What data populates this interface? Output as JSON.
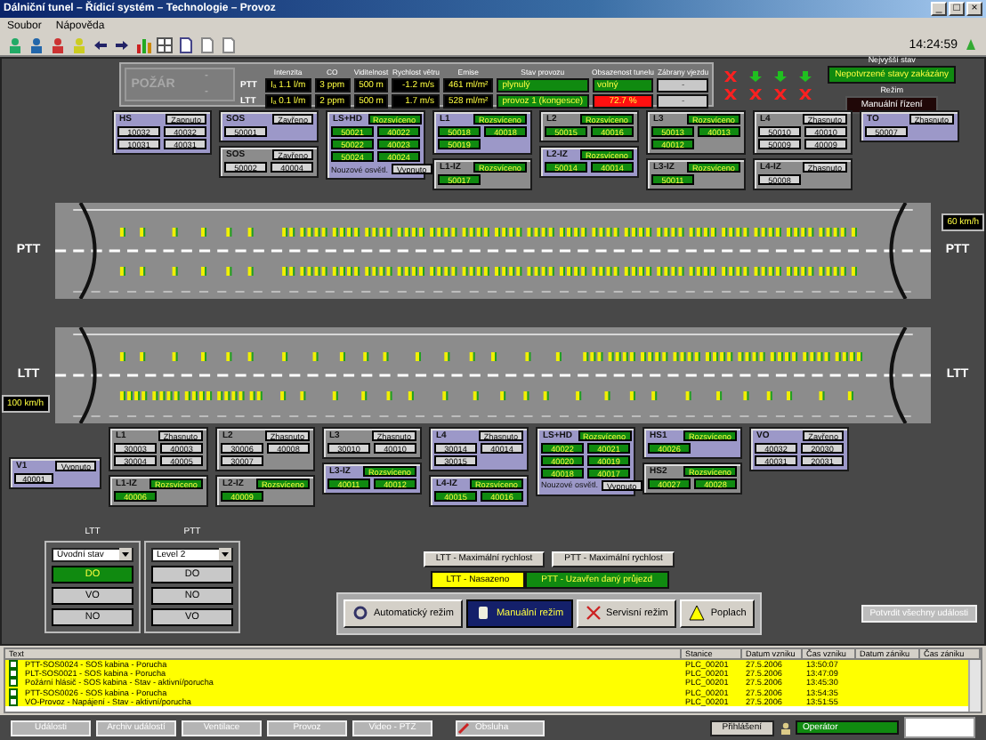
{
  "window": {
    "title": "Dálniční tunel – Řídicí systém – Technologie – Provoz",
    "controls": [
      "_",
      "□",
      "×"
    ]
  },
  "menu": [
    "Soubor",
    "Nápověda"
  ],
  "clock": "14:24:59",
  "fire": {
    "label": "POŽÁR",
    "values": [
      "-",
      "-"
    ]
  },
  "readings": {
    "columns": [
      "Intenzita",
      "CO",
      "Viditelnost",
      "Rychlost větru",
      "Emise",
      "Stav provozu",
      "Obsazenost tunelu",
      "Zábrany vjezdu"
    ],
    "rows": [
      {
        "name": "PTT",
        "cells": [
          {
            "text": "Iₐ 1.1 l/m",
            "kind": "value"
          },
          {
            "text": "3 ppm",
            "kind": "value"
          },
          {
            "text": "500 m",
            "kind": "value"
          },
          {
            "text": "-1.2 m/s",
            "kind": "value"
          },
          {
            "text": "461 ml/m²",
            "kind": "value"
          },
          {
            "text": "plynulý",
            "kind": "status"
          },
          {
            "text": "volný",
            "kind": "status"
          },
          {
            "text": "-",
            "kind": "off"
          }
        ]
      },
      {
        "name": "LTT",
        "cells": [
          {
            "text": "Iₐ 0.1 l/m",
            "kind": "value"
          },
          {
            "text": "2 ppm",
            "kind": "value"
          },
          {
            "text": "500 m",
            "kind": "value"
          },
          {
            "text": "1.7 m/s",
            "kind": "value"
          },
          {
            "text": "528 ml/m²",
            "kind": "value"
          },
          {
            "text": "provoz 1 (kongesce)",
            "kind": "status"
          },
          {
            "text": "72.7 %",
            "kind": "alarm"
          },
          {
            "text": "-",
            "kind": "off"
          }
        ]
      }
    ]
  },
  "signals": [
    {
      "kind": "cross",
      "color": "#ff2020"
    },
    {
      "kind": "arrow",
      "color": "#20c020"
    },
    {
      "kind": "arrow",
      "color": "#20c020"
    },
    {
      "kind": "arrow",
      "color": "#20c020"
    },
    {
      "kind": "cross",
      "color": "#ff2020"
    },
    {
      "kind": "cross",
      "color": "#ff2020"
    },
    {
      "kind": "cross",
      "color": "#ff2020"
    },
    {
      "kind": "cross",
      "color": "#ff2020"
    }
  ],
  "highest_state": {
    "label": "Nejvyšší stav",
    "value": "Nepotvrzené stavy zakázány"
  },
  "mode": {
    "label": "Režim",
    "value": "Manuální řízení"
  },
  "top_columns": [
    {
      "groups": [
        {
          "name": "HS",
          "color": "#9c98c8",
          "status": {
            "text": "Zapnuto",
            "kind": "idle"
          },
          "values": [
            {
              "text": "10032",
              "kind": "idle"
            },
            {
              "text": "40032",
              "kind": "idle"
            },
            {
              "text": "10031",
              "kind": "idle"
            },
            {
              "text": "40031",
              "kind": "idle"
            }
          ]
        }
      ]
    },
    {
      "groups": [
        {
          "name": "SOS",
          "color": "#9c98c8",
          "status": {
            "text": "Zavřeno",
            "kind": "idle"
          },
          "values": [
            {
              "text": "50001",
              "kind": "idle"
            }
          ]
        },
        {
          "name": "SOS",
          "color": "#8c8c8c",
          "status": {
            "text": "Zavřeno",
            "kind": "idle"
          },
          "values": [
            {
              "text": "50002",
              "kind": "idle"
            },
            {
              "text": "40004",
              "kind": "idle"
            }
          ]
        }
      ]
    },
    {
      "groups": [
        {
          "name": "LS+HD",
          "color": "#9c98c8",
          "status": {
            "text": "Rozsvíceno",
            "kind": "active"
          },
          "values": [
            {
              "text": "50021",
              "kind": "active"
            },
            {
              "text": "40022",
              "kind": "active"
            },
            {
              "text": "50022",
              "kind": "active"
            },
            {
              "text": "40023",
              "kind": "active"
            },
            {
              "text": "50024",
              "kind": "active"
            },
            {
              "text": "40024",
              "kind": "active"
            }
          ],
          "footer": {
            "label": "Nouzové osvětl.",
            "status": "Vypnuto"
          }
        }
      ]
    },
    {
      "groups": [
        {
          "name": "L1",
          "color": "#9c98c8",
          "status": {
            "text": "Rozsvíceno",
            "kind": "active"
          },
          "values": [
            {
              "text": "50018",
              "kind": "active"
            },
            {
              "text": "40018",
              "kind": "active"
            },
            {
              "text": "50019",
              "kind": "active"
            }
          ]
        },
        {
          "name": "L1-IZ",
          "color": "#8c8c8c",
          "status": {
            "text": "Rozsvíceno",
            "kind": "active"
          },
          "values": [
            {
              "text": "50017",
              "kind": "active"
            }
          ]
        }
      ]
    },
    {
      "groups": [
        {
          "name": "L2",
          "color": "#8c8c8c",
          "status": {
            "text": "Rozsvíceno",
            "kind": "active"
          },
          "values": [
            {
              "text": "50015",
              "kind": "active"
            },
            {
              "text": "40016",
              "kind": "active"
            }
          ]
        },
        {
          "name": "L2-IZ",
          "color": "#9c98c8",
          "status": {
            "text": "Rozsvíceno",
            "kind": "active"
          },
          "values": [
            {
              "text": "50014",
              "kind": "active"
            },
            {
              "text": "40014",
              "kind": "active"
            }
          ]
        }
      ]
    },
    {
      "groups": [
        {
          "name": "L3",
          "color": "#8c8c8c",
          "status": {
            "text": "Rozsvíceno",
            "kind": "active"
          },
          "values": [
            {
              "text": "50013",
              "kind": "active"
            },
            {
              "text": "40013",
              "kind": "active"
            },
            {
              "text": "40012",
              "kind": "active"
            }
          ]
        },
        {
          "name": "L3-IZ",
          "color": "#8c8c8c",
          "status": {
            "text": "Rozsvíceno",
            "kind": "active"
          },
          "values": [
            {
              "text": "50011",
              "kind": "active"
            }
          ]
        }
      ]
    },
    {
      "groups": [
        {
          "name": "L4",
          "color": "#8c8c8c",
          "status": {
            "text": "Zhasnuto",
            "kind": "idle"
          },
          "values": [
            {
              "text": "50010",
              "kind": "idle"
            },
            {
              "text": "40010",
              "kind": "idle"
            },
            {
              "text": "50009",
              "kind": "idle"
            },
            {
              "text": "40009",
              "kind": "idle"
            }
          ]
        },
        {
          "name": "L4-IZ",
          "color": "#8c8c8c",
          "status": {
            "text": "Zhasnuto",
            "kind": "idle"
          },
          "values": [
            {
              "text": "50008",
              "kind": "idle"
            }
          ]
        }
      ]
    },
    {
      "groups": [
        {
          "name": "TO",
          "color": "#9c98c8",
          "status": {
            "text": "Zhasnuto",
            "kind": "idle"
          },
          "values": [
            {
              "text": "50007",
              "kind": "idle"
            }
          ]
        }
      ]
    }
  ],
  "tubes": [
    {
      "left": {
        "label": "PTT"
      },
      "right": {
        "label": "PTT",
        "speed": "60 km/h"
      }
    },
    {
      "left": {
        "label": "LTT",
        "speed": "100 km/h"
      },
      "right": {
        "label": "LTT"
      }
    }
  ],
  "bottom_columns": [
    {
      "groups": [
        {
          "name": "V1",
          "color": "#9c98c8",
          "status": {
            "text": "Vypnuto",
            "kind": "idle"
          },
          "values": [
            {
              "text": "40001",
              "kind": "idle"
            }
          ]
        }
      ]
    },
    {
      "groups": [
        {
          "name": "L1",
          "color": "#8c8c8c",
          "status": {
            "text": "Zhasnuto",
            "kind": "idle"
          },
          "values": [
            {
              "text": "30003",
              "kind": "idle"
            },
            {
              "text": "40003",
              "kind": "idle"
            },
            {
              "text": "30004",
              "kind": "idle"
            },
            {
              "text": "40005",
              "kind": "idle"
            }
          ]
        },
        {
          "name": "L1-IZ",
          "color": "#8c8c8c",
          "status": {
            "text": "Rozsvíceno",
            "kind": "active"
          },
          "values": [
            {
              "text": "40006",
              "kind": "active"
            }
          ]
        }
      ]
    },
    {
      "groups": [
        {
          "name": "L2",
          "color": "#8c8c8c",
          "status": {
            "text": "Zhasnuto",
            "kind": "idle"
          },
          "values": [
            {
              "text": "30006",
              "kind": "idle"
            },
            {
              "text": "40008",
              "kind": "idle"
            },
            {
              "text": "30007",
              "kind": "idle"
            }
          ]
        },
        {
          "name": "L2-IZ",
          "color": "#8c8c8c",
          "status": {
            "text": "Rozsvíceno",
            "kind": "active"
          },
          "values": [
            {
              "text": "40009",
              "kind": "active"
            }
          ]
        }
      ]
    },
    {
      "groups": [
        {
          "name": "L3",
          "color": "#8c8c8c",
          "status": {
            "text": "Zhasnuto",
            "kind": "idle"
          },
          "values": [
            {
              "text": "30010",
              "kind": "idle"
            },
            {
              "text": "40010",
              "kind": "idle"
            }
          ]
        },
        {
          "name": "L3-IZ",
          "color": "#9c98c8",
          "status": {
            "text": "Rozsvíceno",
            "kind": "active"
          },
          "values": [
            {
              "text": "40011",
              "kind": "active"
            },
            {
              "text": "40012",
              "kind": "active"
            }
          ]
        }
      ]
    },
    {
      "groups": [
        {
          "name": "L4",
          "color": "#9c98c8",
          "status": {
            "text": "Zhasnuto",
            "kind": "idle"
          },
          "values": [
            {
              "text": "30014",
              "kind": "idle"
            },
            {
              "text": "40014",
              "kind": "idle"
            },
            {
              "text": "30015",
              "kind": "idle"
            }
          ]
        },
        {
          "name": "L4-IZ",
          "color": "#9c98c8",
          "status": {
            "text": "Rozsvíceno",
            "kind": "active"
          },
          "values": [
            {
              "text": "40015",
              "kind": "active"
            },
            {
              "text": "40016",
              "kind": "active"
            }
          ]
        }
      ]
    },
    {
      "groups": [
        {
          "name": "LS+HD",
          "color": "#9c98c8",
          "status": {
            "text": "Rozsvíceno",
            "kind": "active"
          },
          "values": [
            {
              "text": "40022",
              "kind": "active"
            },
            {
              "text": "40021",
              "kind": "active"
            },
            {
              "text": "40020",
              "kind": "active"
            },
            {
              "text": "40019",
              "kind": "active"
            },
            {
              "text": "40018",
              "kind": "active"
            },
            {
              "text": "40017",
              "kind": "active"
            }
          ],
          "footer": {
            "label": "Nouzové osvětl.",
            "status": "Vypnuto"
          }
        }
      ]
    },
    {
      "groups": [
        {
          "name": "HS1",
          "color": "#9c98c8",
          "status": {
            "text": "Rozsvíceno",
            "kind": "active"
          },
          "values": [
            {
              "text": "40026",
              "kind": "active"
            }
          ]
        },
        {
          "name": "HS2",
          "color": "#8c8c8c",
          "status": {
            "text": "Rozsvíceno",
            "kind": "active"
          },
          "values": [
            {
              "text": "40027",
              "kind": "active"
            },
            {
              "text": "40028",
              "kind": "active"
            }
          ]
        }
      ]
    },
    {
      "groups": [
        {
          "name": "VO",
          "color": "#9c98c8",
          "status": {
            "text": "Zavřeno",
            "kind": "idle"
          },
          "values": [
            {
              "text": "40032",
              "kind": "idle"
            },
            {
              "text": "20030",
              "kind": "idle"
            },
            {
              "text": "40031",
              "kind": "idle"
            },
            {
              "text": "20031",
              "kind": "idle"
            }
          ]
        }
      ]
    }
  ],
  "selectors": [
    {
      "title": "LTT",
      "value": "Úvodní stav",
      "buttons": [
        {
          "label": "DO",
          "selected": true
        },
        {
          "label": "VO",
          "selected": false
        },
        {
          "label": "NO",
          "selected": false
        }
      ]
    },
    {
      "title": "PTT",
      "value": "Level 2",
      "buttons": [
        {
          "label": "DO",
          "selected": false
        },
        {
          "label": "NO",
          "selected": false
        },
        {
          "label": "VO",
          "selected": false
        }
      ]
    }
  ],
  "speed_buttons": [
    "LTT - Maximální rychlost",
    "PTT - Maximální rychlost"
  ],
  "banners": [
    {
      "text": "LTT - Nasazeno",
      "kind": "warning"
    },
    {
      "text": "PTT - Uzavřen daný průjezd",
      "kind": "ok"
    }
  ],
  "modes": [
    {
      "label": "Automatický režim",
      "selected": false
    },
    {
      "label": "Manuální režim",
      "selected": true
    },
    {
      "label": "Servisní režim",
      "selected": false
    },
    {
      "label": "Poplach",
      "selected": false
    }
  ],
  "confirm_button": "Potvrdit všechny události",
  "events": {
    "columns": [
      "Text",
      "Stanice",
      "Datum vzniku",
      "Čas vzniku",
      "Datum zániku",
      "Čas zániku"
    ],
    "rows": [
      [
        "PTT-SOS0024 - SOS kabina - Porucha",
        "PLC_00201",
        "27.5.2006",
        "13:50:07"
      ],
      [
        "PLT-SOS0021 - SOS kabina - Porucha",
        "PLC_00201",
        "27.5.2006",
        "13:47:09"
      ],
      [
        "Požární hlásič - SOS kabina - Stav - aktivní/porucha",
        "PLC_00201",
        "27.5.2006",
        "13:45:30"
      ],
      [
        "PTT-SOS0026 - SOS kabina - Porucha",
        "PLC_00201",
        "27.5.2006",
        "13:54:35"
      ],
      [
        "VO-Provoz - Napájení - Stav - aktivní/porucha",
        "PLC_00201",
        "27.5.2006",
        "13:51:55"
      ]
    ]
  },
  "bottom_buttons": [
    "Události",
    "Archiv událostí",
    "Ventilace",
    "Provoz",
    "Video - PTZ"
  ],
  "service_button": "Obsluha",
  "login_button": "Přihlášení",
  "user": "Operátor"
}
